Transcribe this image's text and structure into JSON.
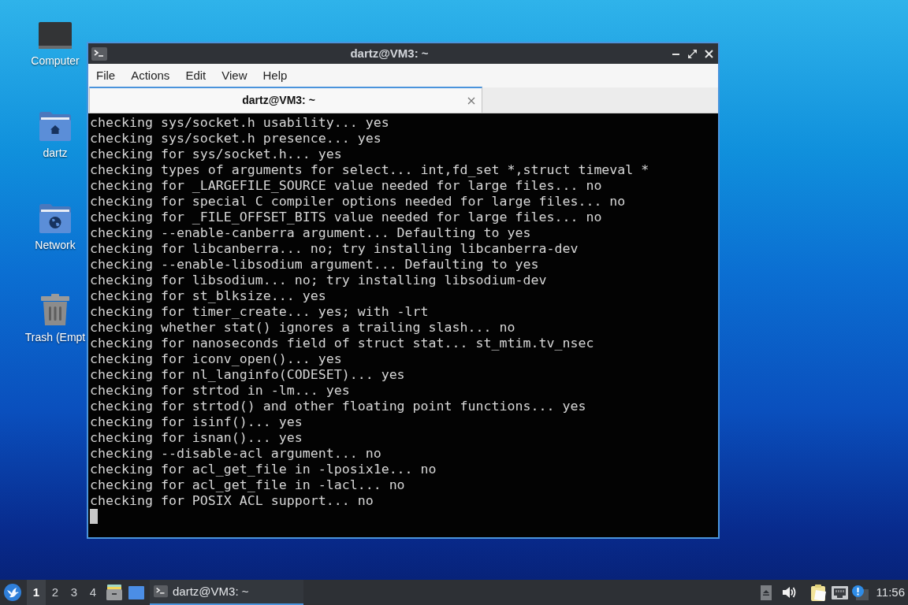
{
  "desktop": {
    "icons": [
      {
        "kind": "computer",
        "label": "Computer"
      },
      {
        "kind": "home",
        "label": "dartz"
      },
      {
        "kind": "network",
        "label": "Network"
      },
      {
        "kind": "trash",
        "label": "Trash (Empt"
      }
    ]
  },
  "window": {
    "title": "dartz@VM3: ~",
    "menu": [
      "File",
      "Actions",
      "Edit",
      "View",
      "Help"
    ],
    "tabs": [
      {
        "label": "dartz@VM3: ~",
        "selected": true
      }
    ],
    "terminal": {
      "lines": [
        "checking sys/socket.h usability... yes",
        "checking sys/socket.h presence... yes",
        "checking for sys/socket.h... yes",
        "checking types of arguments for select... int,fd_set *,struct timeval *",
        "checking for _LARGEFILE_SOURCE value needed for large files... no",
        "checking for special C compiler options needed for large files... no",
        "checking for _FILE_OFFSET_BITS value needed for large files... no",
        "checking --enable-canberra argument... Defaulting to yes",
        "checking for libcanberra... no; try installing libcanberra-dev",
        "checking --enable-libsodium argument... Defaulting to yes",
        "checking for libsodium... no; try installing libsodium-dev",
        "checking for st_blksize... yes",
        "checking for timer_create... yes; with -lrt",
        "checking whether stat() ignores a trailing slash... no",
        "checking for nanoseconds field of struct stat... st_mtim.tv_nsec",
        "checking for iconv_open()... yes",
        "checking for nl_langinfo(CODESET)... yes",
        "checking for strtod in -lm... yes",
        "checking for strtod() and other floating point functions... yes",
        "checking for isinf()... yes",
        "checking for isnan()... yes",
        "checking --disable-acl argument... no",
        "checking for acl_get_file in -lposix1e... no",
        "checking for acl_get_file in -lacl... no",
        "checking for POSIX ACL support... no"
      ]
    }
  },
  "taskbar": {
    "workspaces": [
      {
        "label": "1",
        "selected": true
      },
      {
        "label": "2",
        "selected": false
      },
      {
        "label": "3",
        "selected": false
      },
      {
        "label": "4",
        "selected": false
      }
    ],
    "tasks": [
      {
        "label": "dartz@VM3: ~",
        "selected": true
      }
    ],
    "clock": "11:56"
  }
}
